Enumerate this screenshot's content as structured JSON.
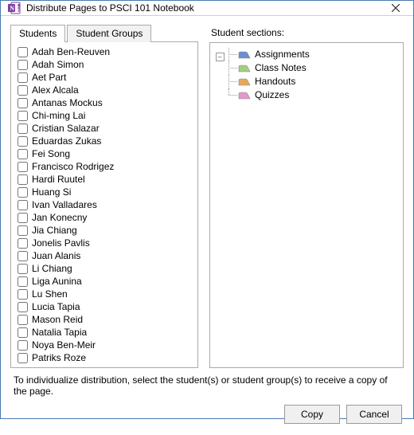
{
  "title": "Distribute Pages to PSCI 101 Notebook",
  "tabs": {
    "students": "Students",
    "groups": "Student Groups"
  },
  "students": [
    "Adah Ben-Reuven",
    "Adah Simon",
    "Aet Part",
    "Alex Alcala",
    "Antanas Mockus",
    "Chi-ming Lai",
    "Cristian Salazar",
    "Eduardas Zukas",
    "Fei Song",
    "Francisco Rodrigez",
    "Hardi Ruutel",
    "Huang Si",
    "Ivan Valladares",
    "Jan Konecny",
    "Jia Chiang",
    "Jonelis Pavlis",
    "Juan Alanis",
    "Li Chiang",
    "Liga Aunina",
    "Lu Shen",
    "Lucia Tapia",
    "Mason Reid",
    "Natalia Tapia",
    "Noya Ben-Meir",
    "Patriks Roze"
  ],
  "sectionsLabel": "Student sections:",
  "sections": [
    {
      "label": "Assignments",
      "color": "#6b8fcf"
    },
    {
      "label": "Class Notes",
      "color": "#9fd17c"
    },
    {
      "label": "Handouts",
      "color": "#e7a85b"
    },
    {
      "label": "Quizzes",
      "color": "#e29acb"
    }
  ],
  "hint": "To individualize distribution, select the student(s) or student group(s) to receive a copy of the page.",
  "buttons": {
    "copy": "Copy",
    "cancel": "Cancel"
  }
}
